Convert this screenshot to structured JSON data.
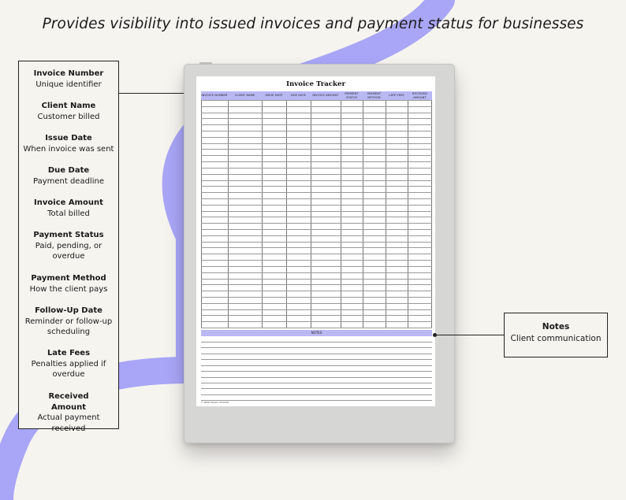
{
  "headline": "Provides visibility into issued invoices and payment status for businesses",
  "legend": [
    {
      "title": "Invoice Number",
      "desc": "Unique identifier"
    },
    {
      "title": "Client Name",
      "desc": "Customer billed"
    },
    {
      "title": "Issue Date",
      "desc": "When invoice was sent"
    },
    {
      "title": "Due Date",
      "desc": "Payment deadline"
    },
    {
      "title": "Invoice Amount",
      "desc": "Total billed"
    },
    {
      "title": "Payment Status",
      "desc": "Paid, pending, or overdue"
    },
    {
      "title": "Payment Method",
      "desc": "How the client pays"
    },
    {
      "title": "Follow-Up Date",
      "desc": "Reminder or follow-up scheduling"
    },
    {
      "title": "Late Fees",
      "desc": "Penalties applied if overdue"
    },
    {
      "title": "Received Amount",
      "desc": "Actual payment received"
    }
  ],
  "notes_callout": {
    "title": "Notes",
    "desc": "Client communication"
  },
  "sheet": {
    "title": "Invoice Tracker",
    "columns": [
      "Invoice Number",
      "Client Name",
      "Issue Date",
      "Due Date",
      "Invoice Amount",
      "Payment Status",
      "Payment Method",
      "Late Fees",
      "Received Amount"
    ],
    "notes_label": "NOTES",
    "credit": "© PRINT MAGIC STUDIOS"
  },
  "colors": {
    "accent": "#a9a6f7",
    "header": "#bab8f3",
    "background": "#f6f4ef"
  }
}
